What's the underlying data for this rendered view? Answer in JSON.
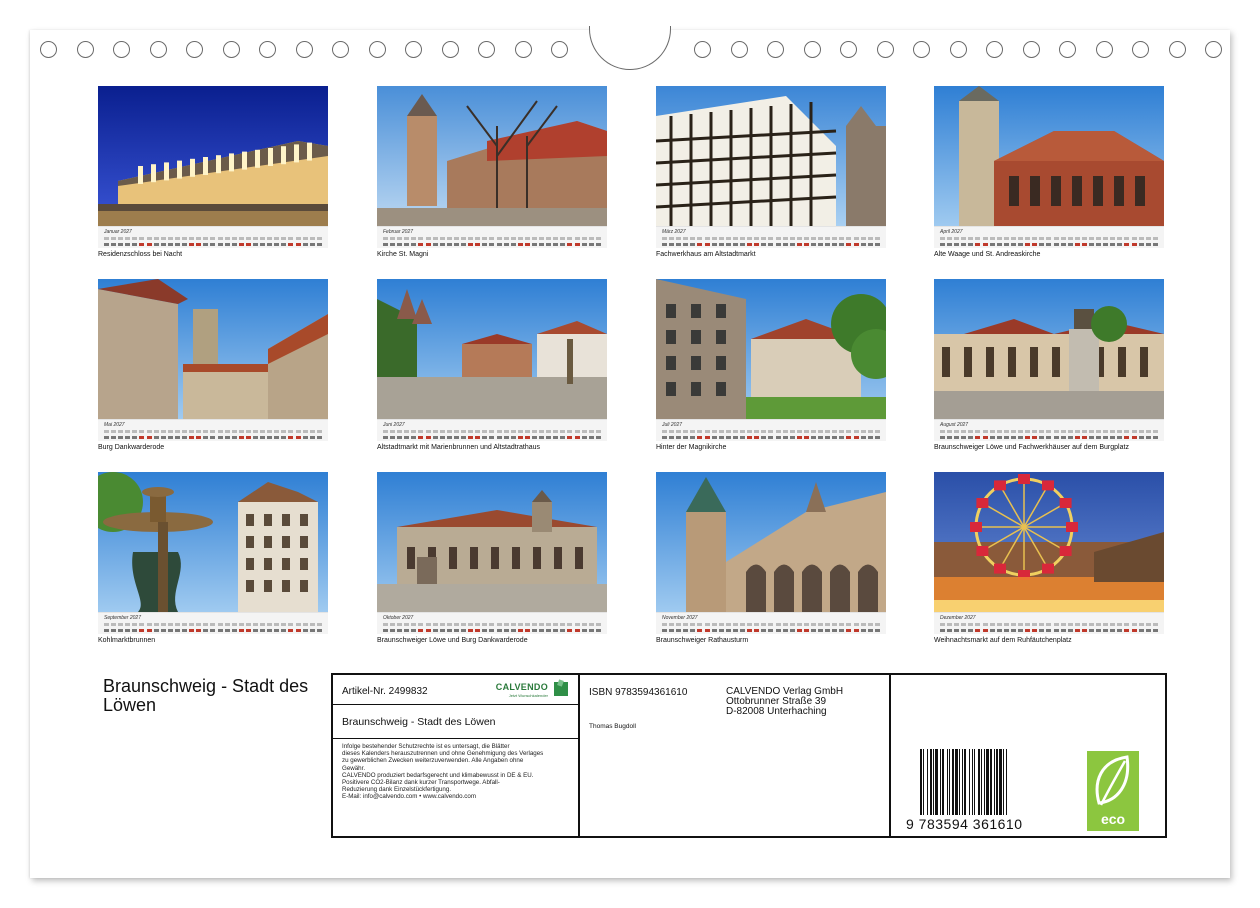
{
  "months": [
    {
      "label": "Januar 2027",
      "caption": "Residenzschloss bei Nacht",
      "scene": "palace-night"
    },
    {
      "label": "Februar 2027",
      "caption": "Kirche St. Magni",
      "scene": "church-trees"
    },
    {
      "label": "März 2027",
      "caption": "Fachwerkhaus am Altstadtmarkt",
      "scene": "timber-house"
    },
    {
      "label": "April 2027",
      "caption": "Alte Waage und St. Andreaskirche",
      "scene": "tower-redhouse"
    },
    {
      "label": "Mai 2027",
      "caption": "Burg Dankwarderode",
      "scene": "castle-courtyard"
    },
    {
      "label": "Juni 2027",
      "caption": "Altstadtmarkt mit Marienbrunnen und Altstadtrathaus",
      "scene": "market-square"
    },
    {
      "label": "Juli 2027",
      "caption": "Hinter der Magnikirche",
      "scene": "lane-houses"
    },
    {
      "label": "August 2027",
      "caption": "Braunschweiger Löwe und Fachwerkhäuser auf dem Burgplatz",
      "scene": "lion-square"
    },
    {
      "label": "September 2027",
      "caption": "Kohlmarktbrunnen",
      "scene": "fountain"
    },
    {
      "label": "Oktober 2027",
      "caption": "Braunschweiger Löwe und Burg Dankwarderode",
      "scene": "castle-front"
    },
    {
      "label": "November 2027",
      "caption": "Braunschweiger Rathausturm",
      "scene": "town-hall"
    },
    {
      "label": "Dezember 2027",
      "caption": "Weihnachtsmarkt auf dem Ruhfäutchenplatz",
      "scene": "ferris-wheel"
    }
  ],
  "title": "Braunschweig - Stadt des Löwen",
  "info": {
    "article": "Artikel-Nr. 2499832",
    "logo_text": "CALVENDO",
    "logo_sub": "Jetzt Wunschkalender",
    "title": "Braunschweig - Stadt des Löwen",
    "legal": [
      "Infolge bestehender Schutzrechte ist es untersagt, die Blätter",
      "dieses Kalenders herauszutrennen und ohne Genehmigung des Verlages",
      "zu gewerblichen Zwecken weiterzuverwenden. Alle Angaben ohne",
      "Gewähr.",
      "CALVENDO produziert bedarfsgerecht und klimabewusst in DE & EU.",
      "Positivere CO2-Bilanz dank kurzer Transportwege. Abfall-",
      "Reduzierung dank Einzelstückfertigung.",
      "E-Mail: info@calvendo.com • www.calvendo.com"
    ],
    "isbn": "ISBN 9783594361610",
    "publisher_lines": [
      "CALVENDO Verlag GmbH",
      "Ottobrunner Straße 39",
      "D-82008 Unterhaching"
    ],
    "author": "Thomas Bugdoll",
    "barcode_digits": "9 783594 361610",
    "eco_label": "eco"
  },
  "colors": {
    "eco_green": "#8cc63f",
    "calvendo_green": "#2f8f47",
    "weekend_red": "#c0392b"
  }
}
